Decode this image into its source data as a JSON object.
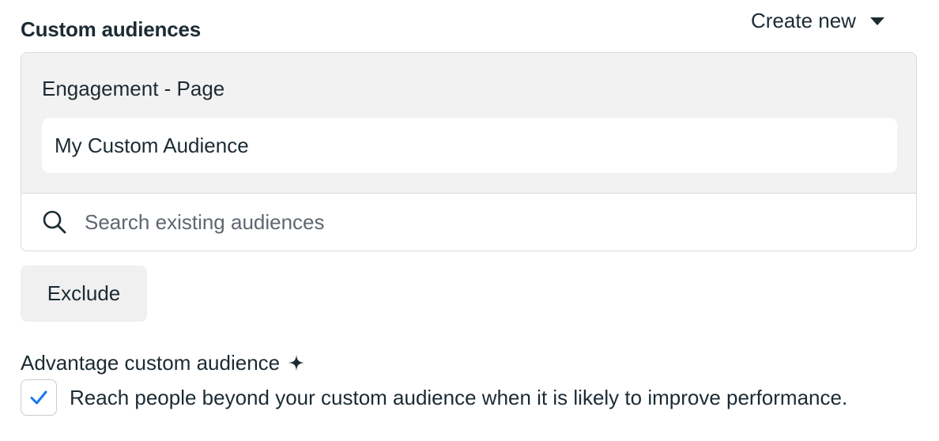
{
  "section": {
    "title": "Custom audiences",
    "create_new_label": "Create new",
    "create_new_icon": "caret-down-icon"
  },
  "audience_box": {
    "group_label": "Engagement - Page",
    "selected_audiences": [
      {
        "name": "My Custom Audience"
      }
    ],
    "search": {
      "placeholder": "Search existing audiences",
      "value": "",
      "icon": "search-icon"
    }
  },
  "exclude_button": {
    "label": "Exclude"
  },
  "advantage": {
    "label": "Advantage custom audience",
    "icon": "sparkle-icon",
    "checkbox": {
      "checked": true,
      "label": "Reach people beyond your custom audience when it is likely to improve performance."
    }
  },
  "colors": {
    "text": "#1c2b33",
    "panel_bg": "#f2f2f2",
    "border": "#d7dadf",
    "check": "#1877f2"
  }
}
